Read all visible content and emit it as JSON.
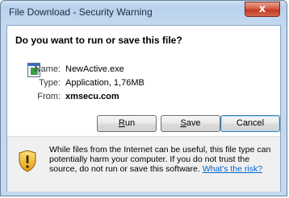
{
  "window": {
    "title": "File Download - Security Warning",
    "close_label": "x"
  },
  "dialog": {
    "heading": "Do you want to run or save this file?",
    "file_icon": "application-window-icon",
    "fields": [
      {
        "label": "Name:",
        "value": "NewActive.exe",
        "bold": false
      },
      {
        "label": "Type:",
        "value": "Application, 1,76MB",
        "bold": false
      },
      {
        "label": "From:",
        "value": "xmsecu.com",
        "bold": true
      }
    ],
    "buttons": {
      "run_accel": "R",
      "run_rest": "un",
      "save_accel": "S",
      "save_rest": "ave",
      "cancel": "Cancel"
    }
  },
  "warning": {
    "icon": "shield-warning-icon",
    "text": "While files from the Internet can be useful, this file type can potentially harm your computer. If you do not trust the source, do not run or save this software. ",
    "link": "What's the risk?"
  },
  "colors": {
    "link": "#0066cc",
    "close_button": "#c23a23",
    "frame": "#c4d9f0"
  }
}
